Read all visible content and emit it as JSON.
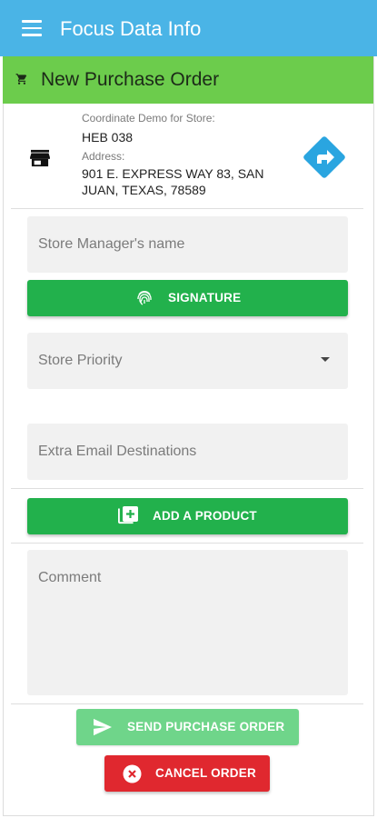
{
  "app": {
    "title": "Focus Data Info"
  },
  "header": {
    "title": "New Purchase Order"
  },
  "store": {
    "coordinate_label": "Coordinate Demo for Store:",
    "store_name": "HEB 038",
    "address_label": "Address:",
    "address_line1": "901 E. EXPRESS WAY 83, SAN",
    "address_line2": "JUAN, TEXAS, 78589"
  },
  "form": {
    "manager_placeholder": "Store Manager's name",
    "signature_label": "SIGNATURE",
    "priority_placeholder": "Store Priority",
    "email_placeholder": "Extra Email Destinations",
    "add_product_label": "ADD A PRODUCT",
    "comment_placeholder": "Comment",
    "send_label": "SEND PURCHASE ORDER",
    "cancel_label": "CANCEL ORDER"
  },
  "colors": {
    "appbar": "#4ab4e6",
    "subbar": "#6ccc4c",
    "primary_button": "#22b14c",
    "send_button_disabled": "#6fd58a",
    "cancel_button": "#e0282f",
    "nav_icon": "#2aa5e0"
  },
  "icons": {
    "menu": "menu-icon",
    "cart": "cart-icon",
    "store": "storefront-icon",
    "directions": "directions-icon",
    "signature": "fingerprint-icon",
    "add_product": "add-box-icon",
    "send": "send-icon",
    "cancel": "cancel-circle-icon",
    "dropdown": "dropdown-arrow-icon"
  }
}
